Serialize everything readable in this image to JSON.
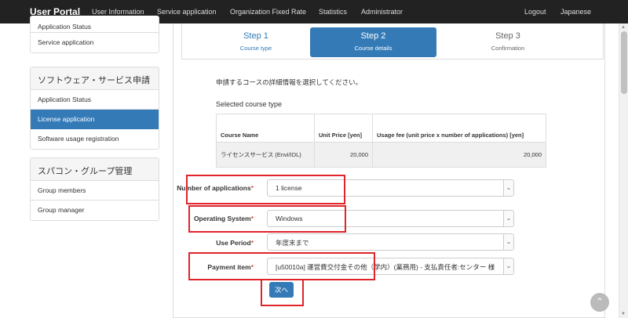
{
  "navbar": {
    "brand": "User Portal",
    "items": [
      "User Information",
      "Service application",
      "Organization Fixed Rate",
      "Statistics",
      "Administrator"
    ],
    "logout": "Logout",
    "language": "Japanese"
  },
  "sidebar": {
    "panel1": {
      "items": [
        "Application Status",
        "Service application"
      ]
    },
    "panel2": {
      "title": "ソフトウェア・サービス申請",
      "items": [
        "Application Status",
        "License application",
        "Software usage registration"
      ],
      "active": "License application"
    },
    "panel3": {
      "title": "スパコン・グループ管理",
      "items": [
        "Group members",
        "Group manager"
      ]
    }
  },
  "steps": [
    {
      "title": "Step 1",
      "subtitle": "Course type",
      "state": "done"
    },
    {
      "title": "Step 2",
      "subtitle": "Course details",
      "state": "active"
    },
    {
      "title": "Step 3",
      "subtitle": "Confirmation",
      "state": "future"
    }
  ],
  "intro": "申請するコースの詳細情報を選択してください。",
  "course": {
    "section_title": "Selected course type",
    "headers": [
      "Course Name",
      "Unit Price [yen]",
      "Usage fee (unit price x number of applications) [yen]"
    ],
    "row": {
      "name": "ライセンスサービス (Envi/IDL)",
      "unit_price": "20,000",
      "usage_fee": "20,000"
    }
  },
  "form": {
    "applications": {
      "label": "Number of applications",
      "value": "1 license"
    },
    "os": {
      "label": "Operating System",
      "value": "Windows"
    },
    "period": {
      "label": "Use Period",
      "value": "年度末まで"
    },
    "payment": {
      "label": "Payment item",
      "value": "[u50010a] 運営費交付金その他（学内）(業務用) - 支払責任者:センター 様"
    },
    "required_mark": "*",
    "next_button": "次へ"
  },
  "colors": {
    "primary": "#337ab7",
    "navbar": "#222222",
    "highlight": "#e0242a",
    "required": "#cc0000"
  },
  "icons": {
    "caret": "chevron-down-icon",
    "back_to_top": "chevron-up-icon"
  }
}
